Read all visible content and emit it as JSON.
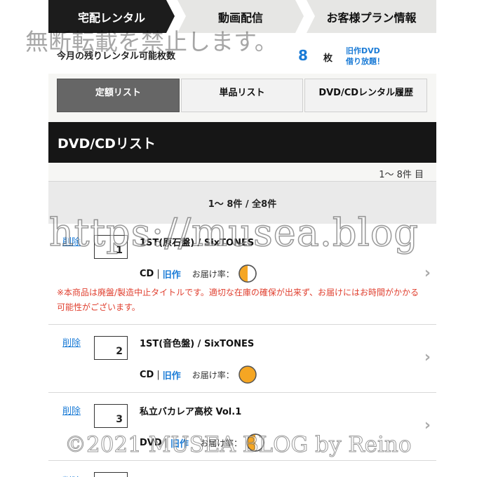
{
  "top_tabs": [
    {
      "label": "宅配レンタル",
      "active": true
    },
    {
      "label": "動画配信",
      "active": false
    },
    {
      "label": "お客様プラン情報",
      "active": false
    }
  ],
  "remaining": {
    "label": "今月の残りレンタル可能枚数",
    "count": "8",
    "unit": "枚",
    "promo_line1": "旧作DVD",
    "promo_line2": "借り放題！"
  },
  "sub_tabs": [
    {
      "label": "定額リスト",
      "active": true
    },
    {
      "label": "単品リスト",
      "active": false
    },
    {
      "label": "DVD/CDレンタル履歴",
      "active": false
    }
  ],
  "section": {
    "title": "DVD/CDリスト"
  },
  "range_label": "1〜 8件 目",
  "pager_label": "1〜 8件 / 全8件",
  "delete_label": "削除",
  "rate_label": "お届け率：",
  "items": [
    {
      "num": "1",
      "title": "1ST(原石盤) / SixTONES",
      "format": "CD",
      "class": "旧作",
      "rate": 0.5,
      "note": "※本商品は廃盤/製造中止タイトルです。適切な在庫の確保が出来ず、お届けにはお時間がかかる可能性がございます。"
    },
    {
      "num": "2",
      "title": "1ST(音色盤) / SixTONES",
      "format": "CD",
      "class": "旧作",
      "rate": 1.0
    },
    {
      "num": "3",
      "title": "私立バカレア高校 Vol.1",
      "format": "DVD",
      "class": "旧作",
      "rate": 0.5
    }
  ],
  "watermarks": {
    "notice": "無断転載を禁止します。",
    "url": "https://musea.blog",
    "copyright": "©2021 MUSEA BLOG by Reino"
  },
  "colors": {
    "link": "#1a7bd6",
    "note": "#e04030",
    "rate_fill": "#f5a623",
    "header_bg": "#161616"
  },
  "icons": {
    "chevron": "chevron-right-icon",
    "rate": "delivery-rate-icon"
  }
}
